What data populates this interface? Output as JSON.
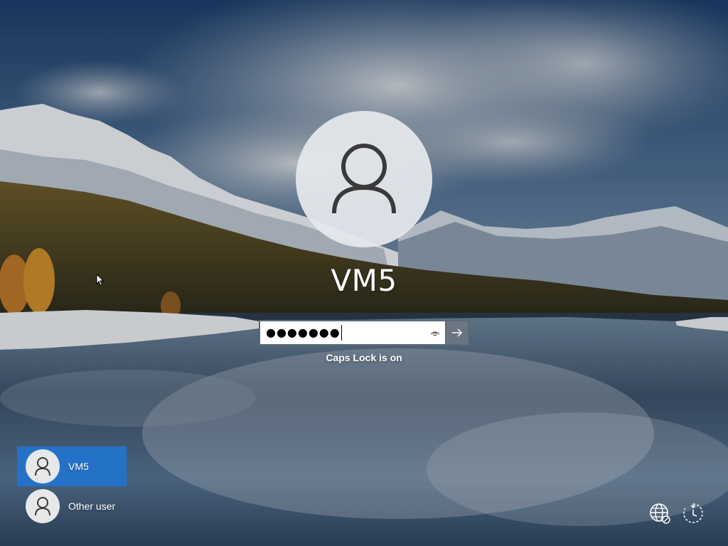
{
  "lock_screen": {
    "selected_user": "VM5",
    "password": {
      "masked_value": "●●●●●●●",
      "reveal_icon": "eye-icon",
      "submit_icon": "arrow-right-icon"
    },
    "caps_lock_message": "Caps Lock is on"
  },
  "user_list": [
    {
      "name": "VM5",
      "selected": true,
      "icon": "user-icon"
    },
    {
      "name": "Other user",
      "selected": false,
      "icon": "user-icon"
    }
  ],
  "corner_buttons": {
    "network_icon": "network-icon",
    "accessibility_icon": "ease-of-access-icon"
  },
  "colors": {
    "selected_user_bg": "#2472c8",
    "avatar_bg": "#e6e8ea",
    "submit_bg": "#6e7882"
  }
}
